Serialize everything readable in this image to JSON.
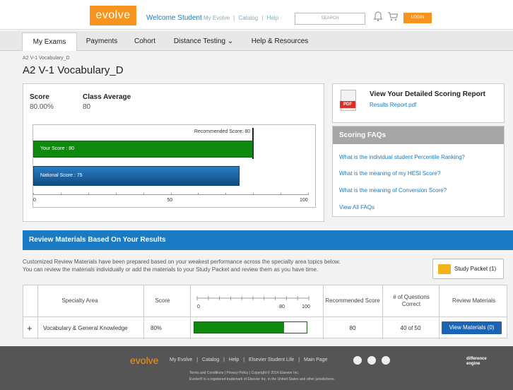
{
  "header": {
    "logo": "evolve",
    "welcome": "Welcome Student",
    "links": [
      "My Evolve",
      "|",
      "Catalog",
      "|",
      "Help"
    ],
    "search_placeholder": "SEARCH",
    "login_label": "LOGIN"
  },
  "nav": {
    "tabs": [
      {
        "label": "My Exams"
      },
      {
        "label": "Payments"
      },
      {
        "label": "Cohort"
      },
      {
        "label": "Distance Testing ⌄"
      },
      {
        "label": "Help & Resources"
      }
    ]
  },
  "breadcrumb": "A2 V-1 Vocabulary_D",
  "page_title": "A2 V-1 Vocabulary_D",
  "score": {
    "score_label": "Score",
    "score_value": "80.00%",
    "avg_label": "Class Average",
    "avg_value": "80"
  },
  "chart_data": {
    "type": "bar",
    "orientation": "horizontal",
    "series": [
      {
        "name": "Your Score",
        "value": 80,
        "label": "Your Score : 80",
        "color": "#0f8a0f"
      },
      {
        "name": "National Score",
        "value": 75,
        "label": "National Score : 75",
        "color": "#1a5f9f"
      }
    ],
    "recommended": {
      "value": 80,
      "label": "Recommended Score: 80"
    },
    "xlim": [
      0,
      100
    ],
    "ticks": [
      "0",
      "50",
      "100"
    ]
  },
  "report": {
    "title": "View Your Detailed Scoring Report",
    "link": "Results Report.pdf",
    "icon_label": "PDF"
  },
  "faq": {
    "title": "Scoring FAQs",
    "items": [
      "What is the individual student Percentile Ranking?",
      "What is the meaning of my HESI Score?",
      "What is the meaning of Conversion Score?",
      "View All FAQs"
    ]
  },
  "review": {
    "title": "Review Materials Based On Your Results",
    "desc_line1": "Customized Review Materials have been prepared based on your weakest performance across the specialty area topics below.",
    "desc_line2": "You can review the materials individually or add the materials to your Study Packet and review them as you have time.",
    "study_packet": "Study Packet (1)",
    "columns": [
      "Specialty Area",
      "Score",
      "Recommended Score",
      "# of Questions Correct",
      "Review Materials"
    ],
    "mini_ticks": [
      "0",
      "80",
      "100"
    ],
    "rows": [
      {
        "expand": "+",
        "area": "Vocabulary & General Knowledge",
        "score": "80%",
        "score_value": 0.8,
        "recommended": "80",
        "correct": "40 of 50",
        "action": "View Materials (0)"
      }
    ]
  },
  "footer": {
    "logo": "evolve",
    "links": [
      "My Evolve",
      "|",
      "Catalog",
      "|",
      "Help",
      "|",
      "Elsevier Student Life",
      "|",
      "Main Page"
    ],
    "legal1": "Terms and Conditions  |  Privacy Policy  |  Copyright © 2014 Elsevier Inc.",
    "legal2": "Evolve® is a registered trademark of Elsevier Inc. in the United States and other jurisdictions.",
    "brand": "difference engine"
  }
}
